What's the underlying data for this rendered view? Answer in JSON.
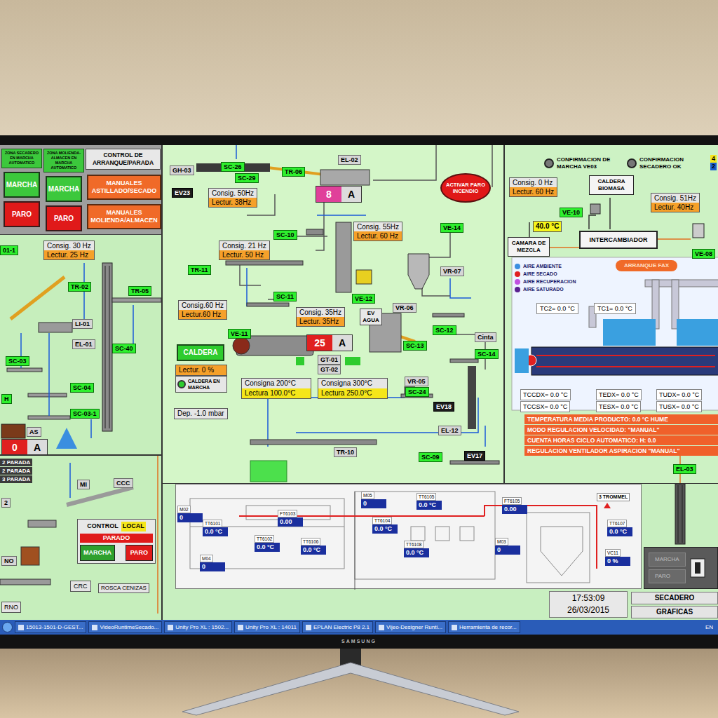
{
  "monitor": {
    "brand": "SAMSUNG"
  },
  "left": {
    "zones": [
      {
        "label": "ZONA SECADERO EN MARCHA AUTOMATICO",
        "start": "MARCHA",
        "stop": "PARO"
      },
      {
        "label": "ZONA MOLIENDA-ALMACEN EN MARCHA AUTOMATICO",
        "start": "MARCHA",
        "stop": "PARO"
      }
    ],
    "control_title": "CONTROL DE ARRANQUE/PARADA",
    "manual_buttons": [
      "MANUALES ASTILLADO/SECADO",
      "MANUALES MOLIENDA/ALMACEN"
    ],
    "setpoint": {
      "consig": "Consig. 30 Hz",
      "lectur": "Lectur. 25 Hz"
    },
    "tags": [
      {
        "text": "01-1",
        "kind": "green"
      },
      {
        "text": "TR-02",
        "kind": "green"
      },
      {
        "text": "TR-05",
        "kind": "green"
      },
      {
        "text": "LI-01",
        "kind": "gray"
      },
      {
        "text": "EL-01",
        "kind": "gray"
      },
      {
        "text": "SC-40",
        "kind": "green"
      },
      {
        "text": "SC-03",
        "kind": "green"
      },
      {
        "text": "SC-04",
        "kind": "green"
      },
      {
        "text": "SC-03-1",
        "kind": "green"
      },
      {
        "text": "H",
        "kind": "green"
      },
      {
        "text": "AS",
        "kind": "gray"
      }
    ],
    "motor": {
      "value": "0",
      "unit": "A",
      "color": "#e02020"
    },
    "parada_rows": [
      "2 PARADA",
      "2 PARADA",
      "3 PARADA"
    ],
    "lower_tags": [
      {
        "text": "MI",
        "kind": "gray"
      },
      {
        "text": "CCC",
        "kind": "gray"
      },
      {
        "text": "2",
        "kind": "gray"
      },
      {
        "text": "NO",
        "kind": "gray"
      }
    ],
    "local_control": {
      "title": "CONTROL",
      "mode": "LOCAL",
      "state": "PARADO",
      "start": "MARCHA",
      "stop": "PARO"
    },
    "buttons": [
      "CRC",
      "ROSCA CENIZAS",
      "RNO"
    ]
  },
  "middle": {
    "tags": [
      {
        "text": "GH-03",
        "kind": "gray"
      },
      {
        "text": "SC-26",
        "kind": "green"
      },
      {
        "text": "SC-29",
        "kind": "green"
      },
      {
        "text": "EV23",
        "kind": "dark"
      },
      {
        "text": "TR-06",
        "kind": "green"
      },
      {
        "text": "EL-02",
        "kind": "gray"
      },
      {
        "text": "SC-10",
        "kind": "green"
      },
      {
        "text": "VE-14",
        "kind": "green"
      },
      {
        "text": "VR-07",
        "kind": "gray"
      },
      {
        "text": "TR-11",
        "kind": "green"
      },
      {
        "text": "SC-11",
        "kind": "green"
      },
      {
        "text": "VE-12",
        "kind": "green"
      },
      {
        "text": "VR-06",
        "kind": "gray"
      },
      {
        "text": "SC-12",
        "kind": "green"
      },
      {
        "text": "VE-11",
        "kind": "green"
      },
      {
        "text": "Cinta",
        "kind": "gray"
      },
      {
        "text": "SC-13",
        "kind": "green"
      },
      {
        "text": "SC-14",
        "kind": "green"
      },
      {
        "text": "GT-01",
        "kind": "gray"
      },
      {
        "text": "GT-02",
        "kind": "gray"
      },
      {
        "text": "VR-05",
        "kind": "gray"
      },
      {
        "text": "SC-24",
        "kind": "green"
      },
      {
        "text": "EV18",
        "kind": "dark"
      },
      {
        "text": "EL-12",
        "kind": "gray"
      },
      {
        "text": "TR-10",
        "kind": "gray"
      },
      {
        "text": "SC-09",
        "kind": "green"
      },
      {
        "text": "EV17",
        "kind": "dark"
      }
    ],
    "setpoints": [
      {
        "consig": "Consig. 50Hz",
        "lectur": "Lectur. 38Hz"
      },
      {
        "consig": "Consig. 21 Hz",
        "lectur": "Lectur. 50 Hz"
      },
      {
        "consig": "Consig. 55Hz",
        "lectur": "Lectur. 60 Hz"
      },
      {
        "consig": "Consig.60 Hz",
        "lectur": "Lectur.60 Hz"
      },
      {
        "consig": "Consig. 35Hz",
        "lectur": "Lectur. 35Hz"
      }
    ],
    "motors": [
      {
        "value": "8",
        "unit": "A",
        "color": "#e0409a"
      },
      {
        "value": "25",
        "unit": "A",
        "color": "#e02020"
      }
    ],
    "fire_button": "ACTIVAR PARO INCENDIO",
    "valve": "EV AGUA",
    "boiler": {
      "label": "CALDERA",
      "reading": "Lectur. 0 %",
      "status": "CALDERA EN MARCHA",
      "running": true
    },
    "temperatures": [
      {
        "consigna": "Consigna 200°C",
        "lectura": "Lectura 100.0°C"
      },
      {
        "consigna": "Consigna 300°C",
        "lectura": "Lectura 250.0°C"
      }
    ],
    "pressure": "Dep. -1.0 mbar"
  },
  "right": {
    "confirmations": [
      "CONFIRMACION DE MARCHA VE03",
      "CONFIRMACION SECADERO OK"
    ],
    "indicators": [
      {
        "text": "4",
        "color": "#f5e61a"
      },
      {
        "text": "2",
        "color": "#1c5fd0"
      }
    ],
    "setpoints": [
      {
        "consig": "Consig. 0 Hz",
        "lectur": "Lectur. 60 Hz"
      },
      {
        "consig": "Consig. 51Hz",
        "lectur": "Lectur. 40Hz"
      }
    ],
    "tags": [
      {
        "text": "VE-10",
        "kind": "green"
      },
      {
        "text": "VE-08",
        "kind": "green"
      },
      {
        "text": "EL-03",
        "kind": "green"
      }
    ],
    "boiler": "CALDERA BIOMASA",
    "mix_temperature": "40.0 °C",
    "mix_chamber": "CAMARA DE MEZCLA",
    "exchanger": "INTERCAMBIADOR",
    "legend": [
      {
        "label": "AIRE AMBIENTE",
        "color": "#3a8ee0"
      },
      {
        "label": "AIRE SECADO",
        "color": "#e02020"
      },
      {
        "label": "AIRE RECUPERACION",
        "color": "#c052e0"
      },
      {
        "label": "AIRE SATURADO",
        "color": "#5a2090"
      }
    ],
    "mode_badge": "ARRANQUE FAX",
    "top_sensors": [
      "TC2= 0.0 °C",
      "TC1= 0.0 °C"
    ],
    "bottom_sensors": [
      "TCCDX= 0.0 °C",
      "TCCSX= 0.0 °C",
      "TEDX= 0.0 °C",
      "TESX= 0.0 °C",
      "TUDX= 0.0 °C",
      "TUSX= 0.0 °C"
    ],
    "info_rows": [
      "TEMPERATURA MEDIA PRODUCTO: 0.0 °C HUME",
      "MODO REGULACION VELOCIDAD: \"MANUAL\"",
      "CUENTA HORAS CICLO AUTOMATICO: H: 0.0",
      "REGULACION VENTILADOR ASPIRACION \"MANUAL\""
    ]
  },
  "process_strip": {
    "trommel": "3 TROMMEL",
    "sensors": [
      {
        "label": "M05",
        "value": "0"
      },
      {
        "label": "TT6105",
        "value": "0.0 °C"
      },
      {
        "label": "FT6105",
        "value": "0.00"
      },
      {
        "label": "TT6104",
        "value": "0.0 °C"
      },
      {
        "label": "FT6103",
        "value": "0.00"
      },
      {
        "label": "TT6101",
        "value": "0.0 °C"
      },
      {
        "label": "TT6102",
        "value": "0.0 °C"
      },
      {
        "label": "TT6106",
        "value": "0.0 °C"
      },
      {
        "label": "M02",
        "value": "0"
      },
      {
        "label": "M04",
        "value": "0"
      },
      {
        "label": "TT6107",
        "value": "0.0 °C"
      },
      {
        "label": "M03",
        "value": "0"
      },
      {
        "label": "TT6108",
        "value": "0.0 °C"
      },
      {
        "label": "VC11",
        "value": "0 %"
      }
    ]
  },
  "dryer_control": {
    "start": "MARCHA",
    "stop": "PARO"
  },
  "clock": {
    "time": "17:53:09",
    "date": "26/03/2015"
  },
  "nav_buttons": [
    "SECADERO",
    "GRAFICAS"
  ],
  "taskbar": {
    "items": [
      "15013-1501-D-GEST...",
      "VideoRuntimeSecado...",
      "Unity Pro XL : 1502...",
      "Unity Pro XL : 14011",
      "EPLAN Electric P8 2.1",
      "Vijeo-Designer Runti...",
      "Herramienta de recor..."
    ],
    "language": "EN"
  }
}
